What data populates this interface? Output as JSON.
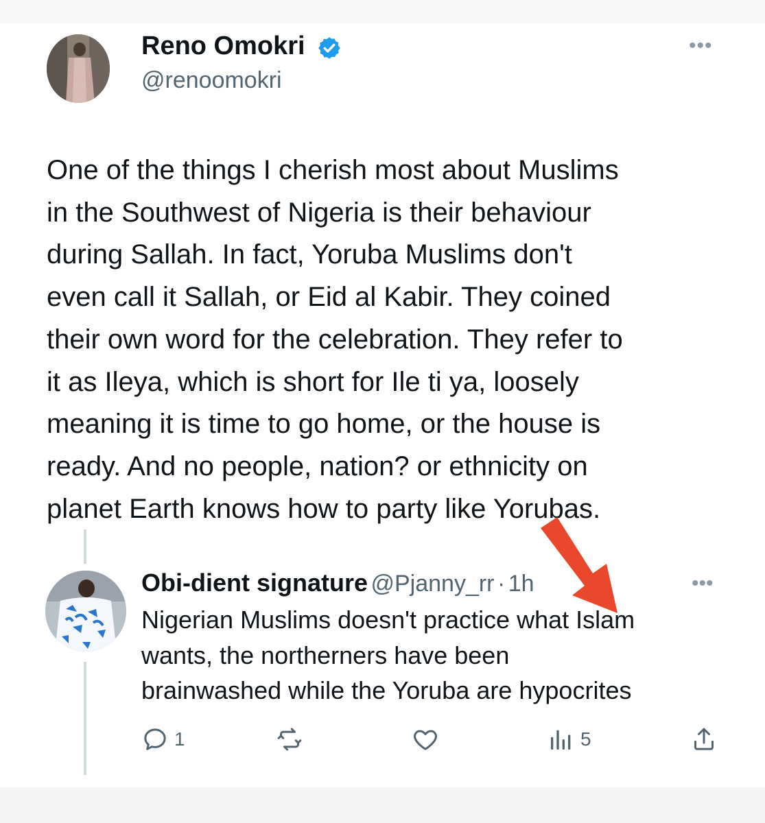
{
  "tweet": {
    "author_name": "Reno Omokri",
    "author_handle": "@renoomokri",
    "text_lines": [
      "One of the things I cherish most about Muslims",
      "in the Southwest of Nigeria is their behaviour",
      "during Sallah. In fact, Yoruba Muslims don't",
      "even call it Sallah, or Eid al Kabir. They coined",
      "their own word for the celebration. They refer to",
      "it as Ileya, which is short for Ile ti ya, loosely",
      "meaning it is time to go home, or the house is",
      "ready. And no people, nation? or ethnicity on",
      "planet Earth knows how to party like Yorubas."
    ]
  },
  "reply": {
    "author_name": "Obi-dient signature",
    "author_handle": "@Pjanny_rr",
    "separator": "·",
    "time": "1h",
    "text_lines": [
      "Nigerian Muslims doesn't practice what Islam",
      "wants, the northerners have been",
      "brainwashed while the Yoruba are hypocrites"
    ],
    "actions": {
      "reply_count": "1",
      "views_count": "5"
    }
  },
  "icons": {
    "verified": "verified-badge-icon",
    "more": "more-dots-icon",
    "reply": "reply-icon",
    "retweet": "retweet-icon",
    "like": "heart-icon",
    "views": "views-icon",
    "share": "share-icon"
  },
  "colors": {
    "verified": "#1d9bf0",
    "arrow_annotation": "#e8472b",
    "secondary_text": "#536471"
  }
}
